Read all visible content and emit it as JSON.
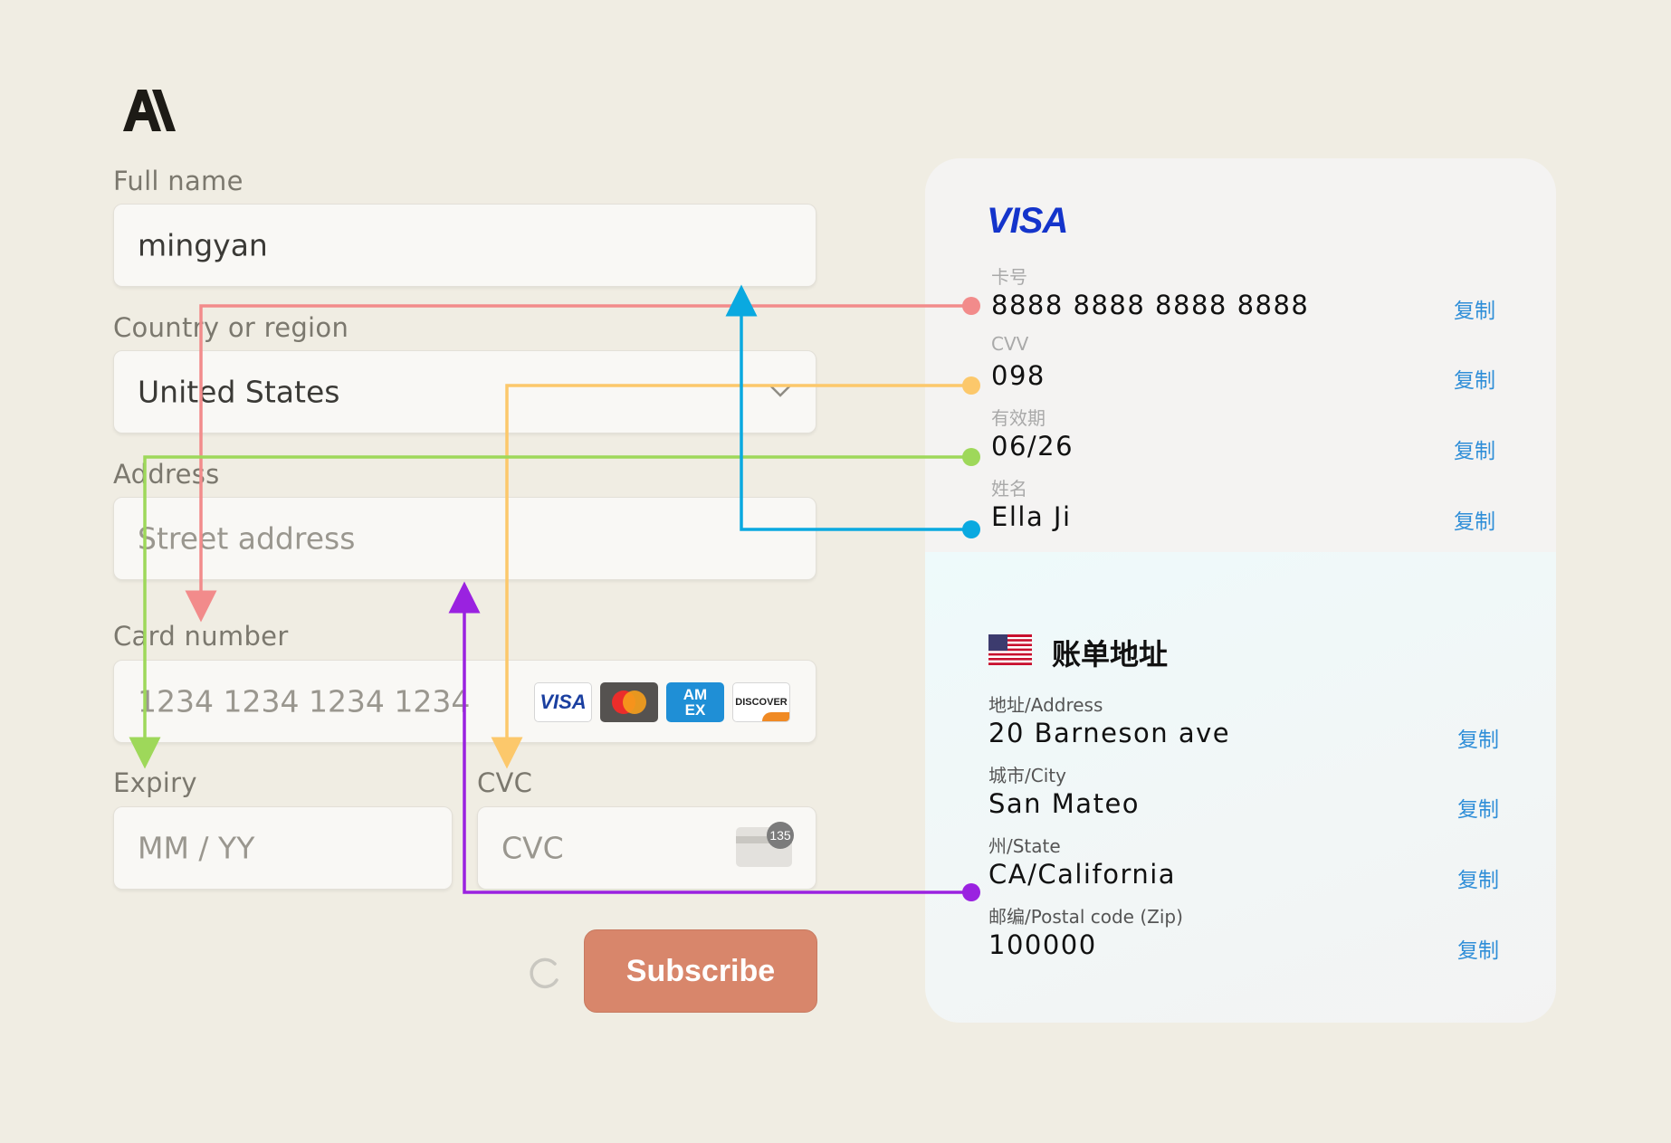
{
  "form": {
    "full_name_label": "Full name",
    "full_name_value": "mingyan",
    "country_label": "Country or region",
    "country_value": "United States",
    "address_label": "Address",
    "address_placeholder": "Street address",
    "card_number_label": "Card number",
    "card_number_placeholder": "1234 1234 1234 1234",
    "card_brands": [
      "VISA",
      "Mastercard",
      "AM EX",
      "DISCOVER"
    ],
    "expiry_label": "Expiry",
    "expiry_placeholder": "MM / YY",
    "cvc_label": "CVC",
    "cvc_placeholder": "CVC",
    "cvc_hint": "135",
    "subscribe_label": "Subscribe"
  },
  "card_info": {
    "brand": "VISA",
    "card_no_label": "卡号",
    "card_no": "8888 8888 8888 8888",
    "cvv_label": "CVV",
    "cvv": "098",
    "expiry_label": "有效期",
    "expiry": "06/26",
    "name_label": "姓名",
    "name": "Ella Ji",
    "copy_label": "复制"
  },
  "billing": {
    "title": "账单地址",
    "address_label": "地址/Address",
    "address": "20 Barneson ave",
    "city_label": "城市/City",
    "city": "San Mateo",
    "state_label": "州/State",
    "state": "CA/California",
    "zip_label": "邮编/Postal code (Zip)",
    "zip": "100000",
    "copy_label": "复制"
  },
  "colors": {
    "card_line": "#f28b8b",
    "cvv_line": "#fcc86b",
    "expiry_line": "#9ed85a",
    "name_line": "#0aa9e0",
    "address_line": "#9a22e0",
    "accent": "#d8866b",
    "copy": "#2f8ed8"
  }
}
